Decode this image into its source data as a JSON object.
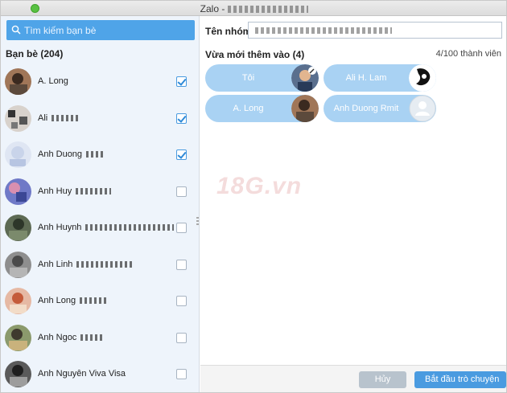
{
  "window": {
    "title": "Zalo -",
    "traffic_color": "#58c142"
  },
  "search": {
    "placeholder": "Tìm kiếm bạn bè"
  },
  "friends": {
    "header": "Bạn bè (204)",
    "items": [
      {
        "name": "A. Long",
        "checked": true
      },
      {
        "name": "Ali",
        "checked": true
      },
      {
        "name": "Anh Duong",
        "checked": true
      },
      {
        "name": "Anh Huy",
        "checked": false
      },
      {
        "name": "Anh Huynh",
        "checked": false
      },
      {
        "name": "Anh Linh",
        "checked": false
      },
      {
        "name": "Anh Long",
        "checked": false
      },
      {
        "name": "Anh Ngoc",
        "checked": false
      },
      {
        "name": "Anh Nguyên Viva Visa",
        "checked": false
      }
    ]
  },
  "group": {
    "label": "Tên nhóm:"
  },
  "recent": {
    "label": "Vừa mới thêm vào (4)",
    "count": "4/100 thành viên",
    "chips": [
      {
        "label": "Tôi"
      },
      {
        "label": "Ali H. Lam"
      },
      {
        "label": "A. Long"
      },
      {
        "label": "Anh Duong Rmit"
      }
    ]
  },
  "watermark": "18G.vn",
  "footer": {
    "cancel_label": "Hủy",
    "start_label": "Bắt đầu trò chuyện"
  },
  "colors": {
    "accent": "#4a9be0",
    "chip": "#a9d2f3",
    "search_bg": "#4fa4e8"
  }
}
